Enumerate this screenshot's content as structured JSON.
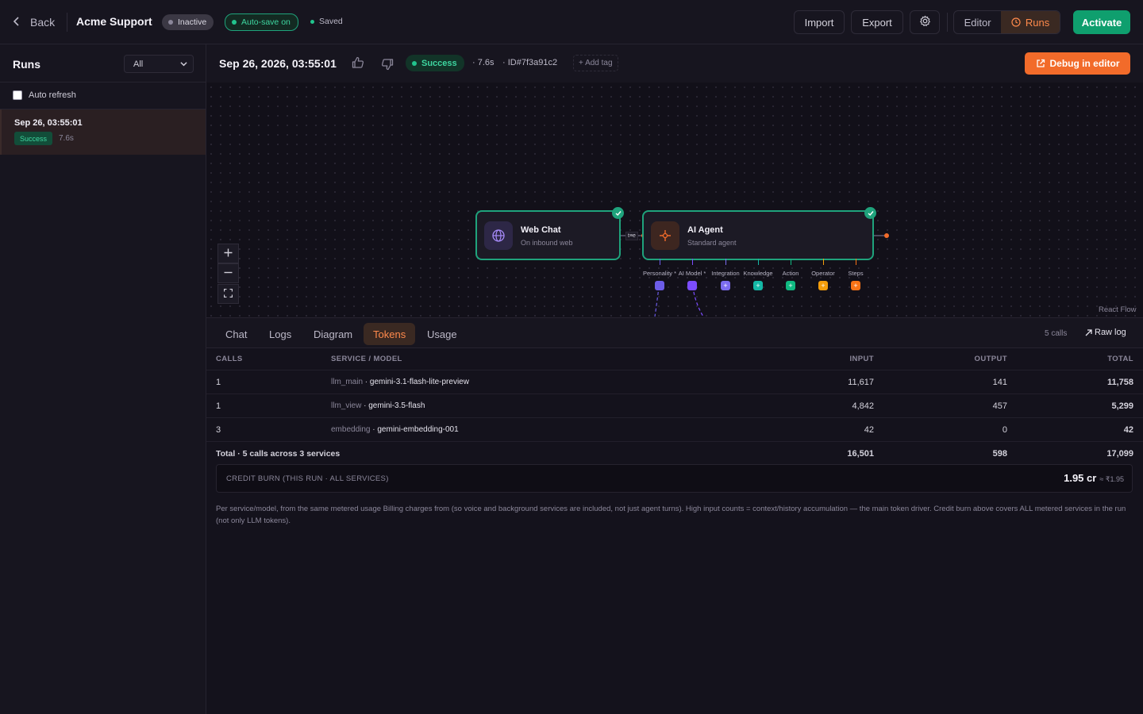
{
  "header": {
    "back_label": "Back",
    "title": "Acme Support",
    "status_badge": "Inactive",
    "autosave_badge": "Auto-save on",
    "saved_label": "Saved",
    "import_label": "Import",
    "export_label": "Export",
    "editor_label": "Editor",
    "runs_label": "Runs",
    "activate_label": "Activate"
  },
  "sidebar": {
    "title": "Runs",
    "filter_value": "All",
    "auto_refresh_label": "Auto refresh",
    "runs": [
      {
        "date": "Sep 26, 03:55:01",
        "status": "Success",
        "duration": "7.6s"
      }
    ]
  },
  "run": {
    "datetime": "Sep 26, 2026, 03:55:01",
    "status": "Success",
    "duration": "· 7.6s",
    "id": "· ID#7f3a91c2",
    "add_tag": "+ Add tag",
    "debug_label": "Debug in editor"
  },
  "flow": {
    "nodes": [
      {
        "title": "Web Chat",
        "subtitle": "On inbound web",
        "icon": "globe-icon"
      },
      {
        "title": "AI Agent",
        "subtitle": "Standard agent",
        "icon": "sparkle-icon"
      }
    ],
    "edge_label": "t≡e",
    "handles": [
      {
        "label": "Personality *",
        "color": "#6c5ce7"
      },
      {
        "label": "AI Model *",
        "color": "#7c4dff"
      },
      {
        "label": "Integration",
        "color": "#7c6cf0"
      },
      {
        "label": "Knowledge",
        "color": "#14b8a6"
      },
      {
        "label": "Action",
        "color": "#10b981"
      },
      {
        "label": "Operator",
        "color": "#f59e0b"
      },
      {
        "label": "Steps",
        "color": "#f97316"
      }
    ],
    "attribution": "React Flow"
  },
  "tabs": [
    "Chat",
    "Logs",
    "Diagram",
    "Tokens",
    "Usage"
  ],
  "active_tab": "Tokens",
  "calls_count": "5 calls",
  "raw_log_label": "Raw log",
  "tokens": {
    "columns": [
      "CALLS",
      "SERVICE / MODEL",
      "INPUT",
      "OUTPUT",
      "TOTAL"
    ],
    "rows": [
      {
        "calls": "1",
        "service": "llm_main",
        "model": "gemini-3.1-flash-lite-preview",
        "input": "11,617",
        "output": "141",
        "total": "11,758"
      },
      {
        "calls": "1",
        "service": "llm_view",
        "model": "gemini-3.5-flash",
        "input": "4,842",
        "output": "457",
        "total": "5,299"
      },
      {
        "calls": "3",
        "service": "embedding",
        "model": "gemini-embedding-001",
        "input": "42",
        "output": "0",
        "total": "42"
      }
    ],
    "total": {
      "label": "Total · 5 calls across 3 services",
      "input": "16,501",
      "output": "598",
      "total": "17,099"
    },
    "credit_label": "CREDIT BURN (THIS RUN · ALL SERVICES)",
    "credit_value": "1.95 cr",
    "credit_inr": "≈ ₹1.95",
    "note": "Per service/model, from the same metered usage Billing charges from (so voice and background services are included, not just agent turns). High input counts = context/history accumulation — the main token driver. Credit burn above covers ALL metered services in the run (not only LLM tokens)."
  },
  "colors": {
    "accent_orange": "#f26b2a",
    "success_green": "#1fa37c",
    "activate_green": "#0f9f6e"
  }
}
